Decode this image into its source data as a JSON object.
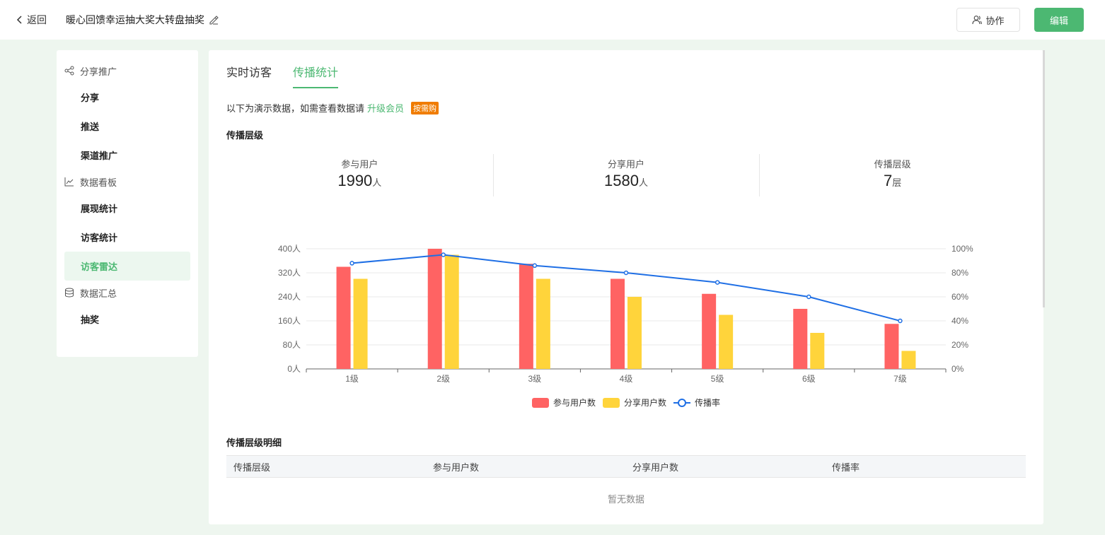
{
  "header": {
    "back_label": "返回",
    "title": "暖心回馈幸运抽大奖大转盘抽奖",
    "collab_label": "协作",
    "edit_label": "编辑"
  },
  "sidebar": {
    "groups": [
      {
        "label": "分享推广",
        "icon": "share-icon",
        "items": [
          "分享",
          "推送",
          "渠道推广"
        ]
      },
      {
        "label": "数据看板",
        "icon": "line-chart-icon",
        "items": [
          "展现统计",
          "访客统计",
          "访客雷达"
        ]
      },
      {
        "label": "数据汇总",
        "icon": "database-icon",
        "items": [
          "抽奖"
        ]
      }
    ],
    "active_item": "访客雷达"
  },
  "tabs": [
    {
      "label": "实时访客"
    },
    {
      "label": "传播统计"
    }
  ],
  "active_tab": "传播统计",
  "notice": {
    "text": "以下为演示数据，如需查看数据请",
    "link": "升级会员",
    "badge": "按需购"
  },
  "section1_title": "传播层级",
  "stats": [
    {
      "label": "参与用户",
      "value": "1990",
      "unit": "人"
    },
    {
      "label": "分享用户",
      "value": "1580",
      "unit": "人"
    },
    {
      "label": "传播层级",
      "value": "7",
      "unit": "层"
    }
  ],
  "chart_data": {
    "type": "bar",
    "categories": [
      "1级",
      "2级",
      "3级",
      "4级",
      "5级",
      "6级",
      "7级"
    ],
    "series": [
      {
        "name": "参与用户数",
        "type": "bar",
        "axis": "left",
        "color": "#ff6363",
        "values": [
          340,
          400,
          350,
          300,
          250,
          200,
          150
        ]
      },
      {
        "name": "分享用户数",
        "type": "bar",
        "axis": "left",
        "color": "#ffd43b",
        "values": [
          300,
          380,
          300,
          240,
          180,
          120,
          60
        ]
      },
      {
        "name": "传播率",
        "type": "line",
        "axis": "right",
        "color": "#1f6fe5",
        "values": [
          88,
          95,
          86,
          80,
          72,
          60,
          40
        ]
      }
    ],
    "left_axis": {
      "ticks": [
        "0人",
        "80人",
        "160人",
        "240人",
        "320人",
        "400人"
      ],
      "ylim": [
        0,
        400
      ]
    },
    "right_axis": {
      "ticks": [
        "0%",
        "20%",
        "40%",
        "60%",
        "80%",
        "100%"
      ],
      "ylim": [
        0,
        100
      ]
    },
    "legend_position": "bottom",
    "grid": true
  },
  "section2_title": "传播层级明细",
  "table": {
    "columns": [
      "传播层级",
      "参与用户数",
      "分享用户数",
      "传播率"
    ],
    "empty_text": "暂无数据"
  }
}
